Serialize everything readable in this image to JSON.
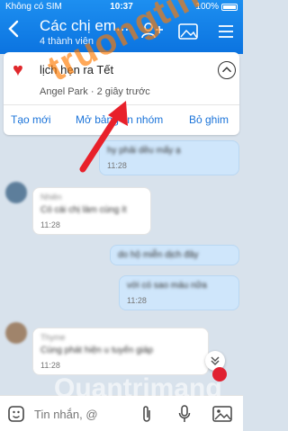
{
  "status": {
    "carrier": "Không có SIM",
    "time": "10:37",
    "battery": "100%"
  },
  "header": {
    "title": "Các chị em...",
    "subtitle": "4 thành viên"
  },
  "pinned": {
    "title": "lịch hẹn ra Tết",
    "meta": "Angel Park · 2 giây trước",
    "actions": [
      "Tạo mới",
      "Mở bảng tin nhóm",
      "Bỏ ghim"
    ]
  },
  "messages": [
    {
      "side": "out",
      "text": "hy phải dều mấy ạ",
      "time": "11:28"
    },
    {
      "side": "in",
      "sender": "Nhiên",
      "text": "Có cái chị làm cùng ít",
      "time": "11:28"
    },
    {
      "side": "out",
      "text": "do hộ miễn dịch đây",
      "time": ""
    },
    {
      "side": "out",
      "text": "với có sao máu nữa",
      "time": "11:28"
    },
    {
      "side": "in",
      "sender": "Thyme",
      "text": "Cùng phát hiện u tuyến giáp",
      "time": "11:28"
    }
  ],
  "input": {
    "placeholder": "Tin nhắn, @"
  },
  "watermark": {
    "text": "truongtin",
    "text2": "Quantrimang"
  },
  "colors": {
    "header": "#0b73e0",
    "accent": "#1a73d9",
    "arrow": "#e8202a"
  }
}
